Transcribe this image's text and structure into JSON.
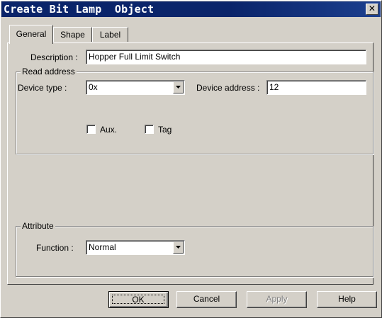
{
  "window": {
    "title": "Create Bit Lamp  Object",
    "close_glyph": "✕"
  },
  "tabs": [
    {
      "label": "General",
      "active": true
    },
    {
      "label": "Shape",
      "active": false
    },
    {
      "label": "Label",
      "active": false
    }
  ],
  "general": {
    "description_label": "Description :",
    "description_value": "Hopper Full Limit Switch",
    "read_address": {
      "title": "Read address",
      "device_type_label": "Device type :",
      "device_type_value": "0x",
      "device_address_label": "Device address :",
      "device_address_value": "12",
      "aux_label": "Aux.",
      "aux_checked": false,
      "tag_label": "Tag",
      "tag_checked": false
    },
    "attribute": {
      "title": "Attribute",
      "function_label": "Function :",
      "function_value": "Normal"
    }
  },
  "buttons": {
    "ok": "OK",
    "cancel": "Cancel",
    "apply": "Apply",
    "help": "Help"
  },
  "colors": {
    "title_bar": "#0a246a",
    "face": "#d4d0c8"
  }
}
